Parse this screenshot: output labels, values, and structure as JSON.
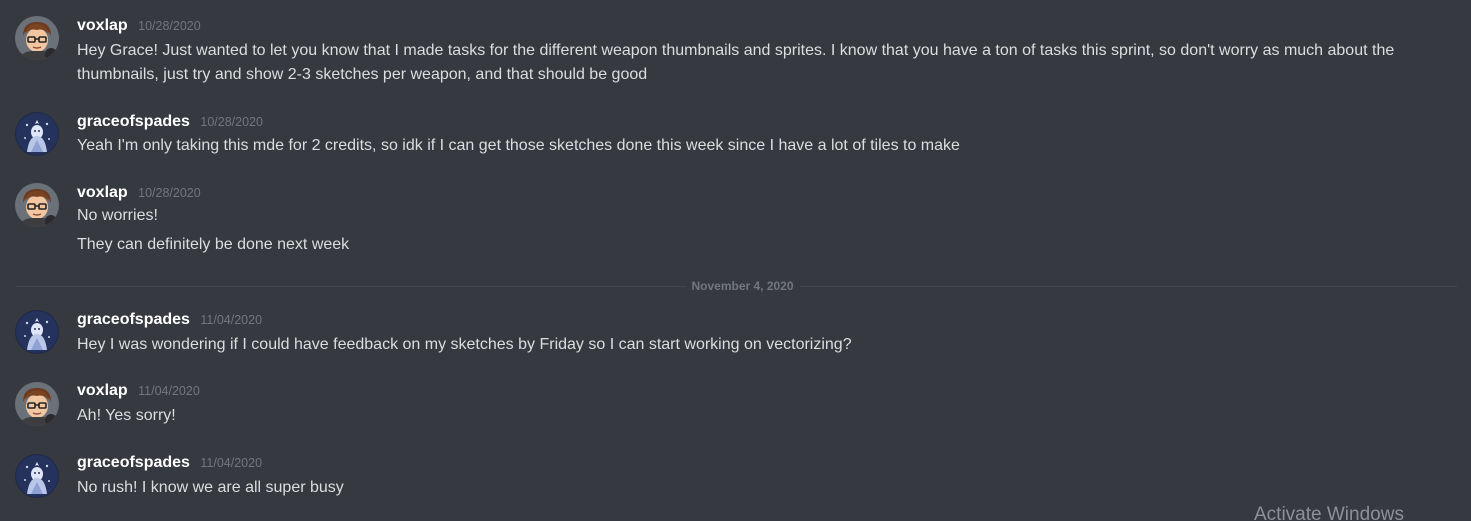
{
  "messages": [
    {
      "username": "voxlap",
      "timestamp": "10/28/2020",
      "lines": [
        "Hey Grace! Just wanted to let you know that I made tasks for the different weapon thumbnails and sprites. I know that you have a ton of tasks this sprint, so don't worry as much about the",
        "thumbnails, just try and show 2-3 sketches per weapon, and that should be good"
      ]
    },
    {
      "username": "graceofspades",
      "timestamp": "10/28/2020",
      "lines": [
        "Yeah I'm only taking this mde for 2 credits, so idk if I can get those sketches done this week since I have a lot of tiles to make"
      ]
    },
    {
      "username": "voxlap",
      "timestamp": "10/28/2020",
      "lines": [
        "No worries!",
        "They can definitely be done next week"
      ]
    },
    {
      "username": "graceofspades",
      "timestamp": "11/04/2020",
      "lines": [
        "Hey I was wondering if I could have feedback on my sketches by Friday so I can start working on vectorizing?"
      ]
    },
    {
      "username": "voxlap",
      "timestamp": "11/04/2020",
      "lines": [
        "Ah! Yes sorry!"
      ]
    },
    {
      "username": "graceofspades",
      "timestamp": "11/04/2020",
      "lines": [
        "No rush! I know we are all super busy"
      ]
    }
  ],
  "date_divider": "November 4, 2020",
  "watermark": "Activate Windows",
  "colors": {
    "background": "#36393f",
    "username": "#ffffff",
    "message_text": "#dcddde",
    "timestamp": "#72767d",
    "divider": "#42454a"
  },
  "icons": {
    "voxlap_avatar": "avatar-cartoon-boy-glasses-icon",
    "graceofspades_avatar": "avatar-ghost-figure-icon"
  }
}
